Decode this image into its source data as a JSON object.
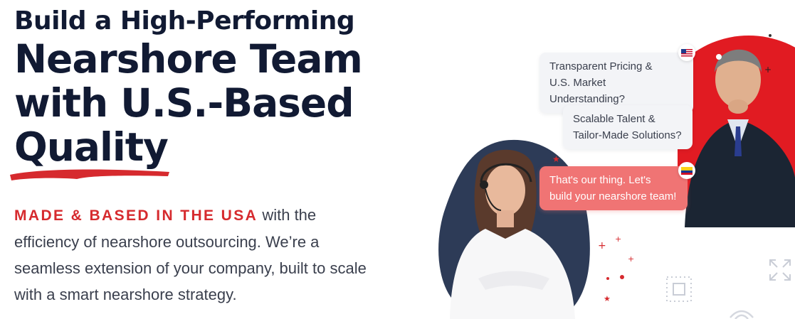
{
  "hero": {
    "headline_line1": "Build a High-Performing",
    "headline_line2": "Nearshore Team",
    "headline_line3": "with U.S.-Based",
    "headline_line4": "Quality",
    "accent_text": "MADE & BASED IN THE USA",
    "body_text": " with the efficiency of nearshore outsourcing. We’re a seamless extension of your company, built to scale with a smart nearshore strategy."
  },
  "chat": {
    "bubble1_line1": "Transparent Pricing &",
    "bubble1_line2": "U.S. Market Understanding?",
    "bubble2_line1": "Scalable Talent &",
    "bubble2_line2": "Tailor-Made Solutions?",
    "bubble3_line1": "That's our thing. Let's",
    "bubble3_line2": "build your nearshore team!"
  },
  "colors": {
    "navy": "#111a33",
    "brand_red": "#d62a2e",
    "bubble_red": "#f07474",
    "bubble_grey": "#f3f4f7"
  },
  "icons": {
    "us_flag": "us-flag-icon",
    "colombia_flag": "colombia-flag-icon",
    "expand": "expand-arrows-icon",
    "frame": "dotted-frame-icon",
    "wifi": "wifi-icon"
  }
}
